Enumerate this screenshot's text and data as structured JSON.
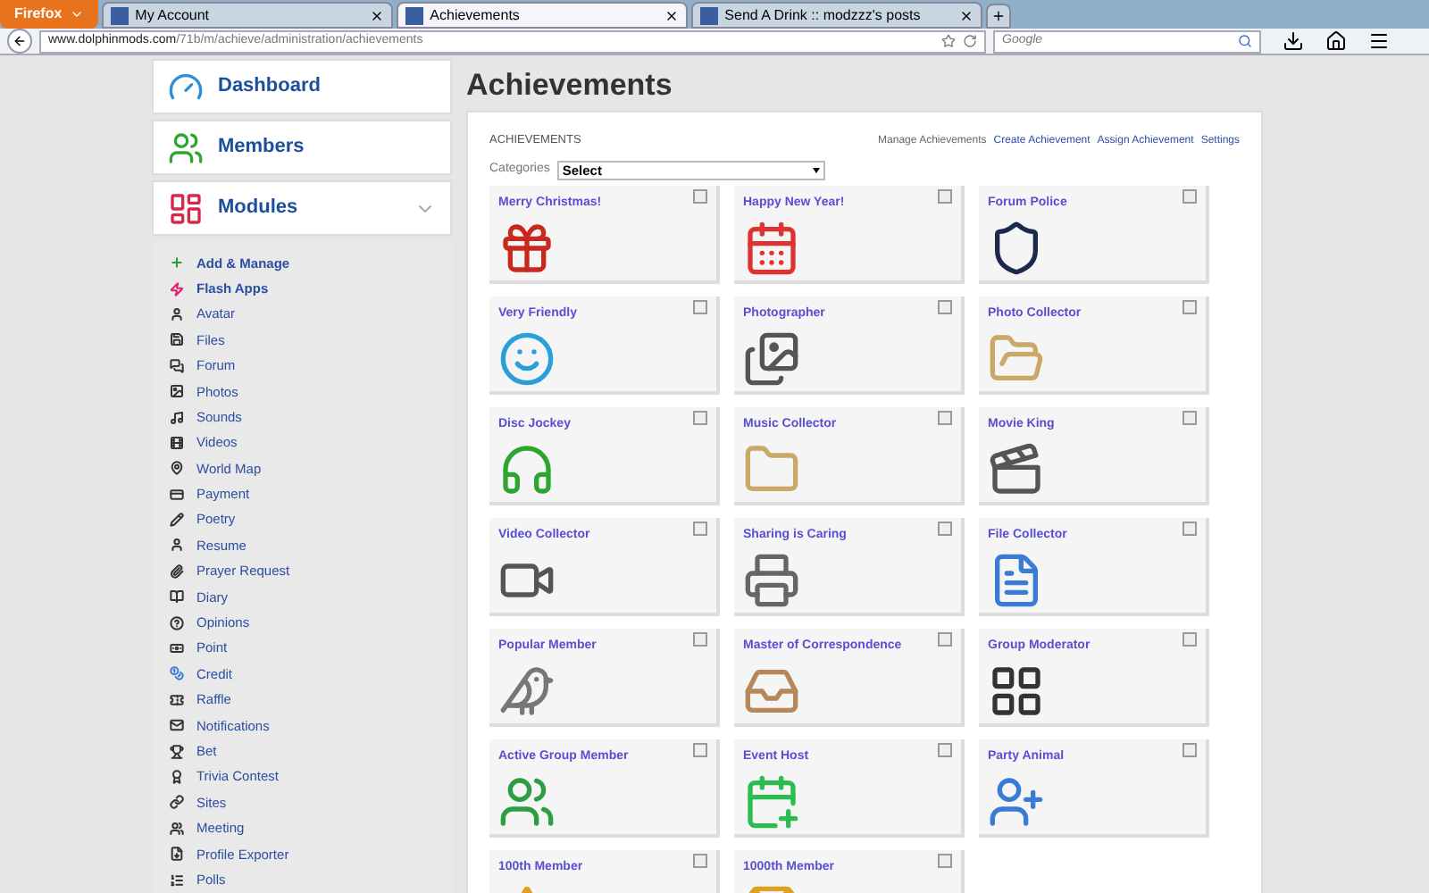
{
  "browser": {
    "menu_button": "Firefox",
    "tabs": [
      {
        "label": "My Account",
        "selected": false
      },
      {
        "label": "Achievements",
        "selected": true
      },
      {
        "label": "Send A Drink :: modzzz's posts",
        "selected": false
      }
    ],
    "address": {
      "domain": "www.dolphinmods.com",
      "path": "/71b/m/achieve/administration/achievements"
    },
    "search": {
      "placeholder": "Google"
    }
  },
  "sidebar": {
    "sections": [
      {
        "label": "Dashboard",
        "kind": "dashboard"
      },
      {
        "label": "Members",
        "kind": "members"
      },
      {
        "label": "Modules",
        "kind": "modules"
      }
    ],
    "items": [
      {
        "label": "Add & Manage",
        "bold": true
      },
      {
        "label": "Flash Apps",
        "bold": true
      },
      {
        "label": "Avatar",
        "bold": false
      },
      {
        "label": "Files",
        "bold": false
      },
      {
        "label": "Forum",
        "bold": false
      },
      {
        "label": "Photos",
        "bold": false
      },
      {
        "label": "Sounds",
        "bold": false
      },
      {
        "label": "Videos",
        "bold": false
      },
      {
        "label": "World Map",
        "bold": false
      },
      {
        "label": "Payment",
        "bold": false
      },
      {
        "label": "Poetry",
        "bold": false
      },
      {
        "label": "Resume",
        "bold": false
      },
      {
        "label": "Prayer Request",
        "bold": false
      },
      {
        "label": "Diary",
        "bold": false
      },
      {
        "label": "Opinions",
        "bold": false
      },
      {
        "label": "Point",
        "bold": false
      },
      {
        "label": "Credit",
        "bold": false
      },
      {
        "label": "Raffle",
        "bold": false
      },
      {
        "label": "Notifications",
        "bold": false
      },
      {
        "label": "Bet",
        "bold": false
      },
      {
        "label": "Trivia Contest",
        "bold": false
      },
      {
        "label": "Sites",
        "bold": false
      },
      {
        "label": "Meeting",
        "bold": false
      },
      {
        "label": "Profile Exporter",
        "bold": false
      },
      {
        "label": "Polls",
        "bold": false
      }
    ]
  },
  "page_title": "Achievements",
  "panel": {
    "title": "ACHIEVEMENTS",
    "links": [
      {
        "label": "Manage Achievements",
        "selected": true
      },
      {
        "label": "Create Achievement",
        "selected": false
      },
      {
        "label": "Assign Achievement",
        "selected": false
      },
      {
        "label": "Settings",
        "selected": false
      }
    ],
    "categories": {
      "label": "Categories",
      "value": "Select"
    },
    "achievements": [
      {
        "name": "Merry Christmas!",
        "checked": false
      },
      {
        "name": "Happy New Year!",
        "checked": false
      },
      {
        "name": "Forum Police",
        "checked": false
      },
      {
        "name": "Very Friendly",
        "checked": false
      },
      {
        "name": "Photographer",
        "checked": false
      },
      {
        "name": "Photo Collector",
        "checked": false
      },
      {
        "name": "Disc Jockey",
        "checked": false
      },
      {
        "name": "Music Collector",
        "checked": false
      },
      {
        "name": "Movie King",
        "checked": false
      },
      {
        "name": "Video Collector",
        "checked": false
      },
      {
        "name": "Sharing is Caring",
        "checked": false
      },
      {
        "name": "File Collector",
        "checked": false
      },
      {
        "name": "Popular Member",
        "checked": false
      },
      {
        "name": "Master of Correspondence",
        "checked": false
      },
      {
        "name": "Group Moderator",
        "checked": false
      },
      {
        "name": "Active Group Member",
        "checked": false
      },
      {
        "name": "Event Host",
        "checked": false
      },
      {
        "name": "Party Animal",
        "checked": false
      },
      {
        "name": "100th Member",
        "checked": false
      },
      {
        "name": "1000th Member",
        "checked": false
      }
    ]
  }
}
